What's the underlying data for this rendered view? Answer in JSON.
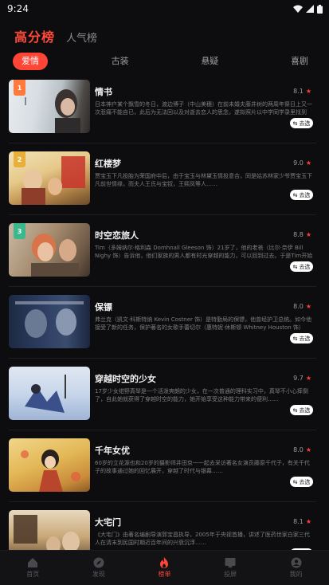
{
  "status": {
    "time": "9:24"
  },
  "top_tabs": {
    "active": "高分榜",
    "other": "人气榜"
  },
  "categories": [
    {
      "label": "爱情",
      "active": true
    },
    {
      "label": "古装",
      "active": false
    },
    {
      "label": "悬疑",
      "active": false
    },
    {
      "label": "喜剧",
      "active": false
    }
  ],
  "movies": [
    {
      "rank": "1",
      "title": "情书",
      "score": "8.1",
      "desc": "日本神户某个飘雪的冬日，渡边博子（中山美穗）在前未婚夫藤井树的两周年祭日上又一次悲痛不能自已，此后为无法回以及对逝去恋人的思念，遂拟照片以中学同学录里找到",
      "button": "去选"
    },
    {
      "rank": "2",
      "title": "红楼梦",
      "score": "9.0",
      "desc": "贾宝玉下凡投胎为荣国府中后，由于宝玉与林黛玉情投意合，同是姑苏林家少爷贾宝玉下凡前世情缘，而夫人王氏与宝钗，王熙凤等人……",
      "button": "去选"
    },
    {
      "rank": "3",
      "title": "时空恋旅人",
      "score": "8.8",
      "desc": "Tim（多姆纳尔·格利森 Domhnall Gleeson 饰）21岁了，他的老爸（比尔·奈伊 Bill Nighy 饰）告诉他，他们家族的男人都有时光穿越的能力，可以回到过去。于是Tim开始使用这种能力",
      "button": "去选"
    },
    {
      "rank": "",
      "title": "保镖",
      "score": "8.0",
      "desc": "弗兰克（凯文·科斯特纳 Kevin Costner 饰）是特勤局的保镖，他曾经护卫总统。如今他接受了新的任务，保护著名的女歌手蕾切尔（惠特妮·休斯顿 Whitney Houston 饰）",
      "button": "去选"
    },
    {
      "rank": "",
      "title": "穿越时空的少女",
      "score": "9.7",
      "desc": "17岁少女绀野真琴是一个活泼爽朗的少女，在一次普通的理科实习中，真琴不小心摔倒了，自此她就获得了穿越时空的能力，她开始享受这种能力带来的便利……",
      "button": "去选"
    },
    {
      "rank": "",
      "title": "千年女优",
      "score": "8.0",
      "desc": "60岁的立花源也和20岁的摄影师井田京一一起去采访著名女演员藤原千代子，有关千代子的故事通过她的回忆展开，穿越了时代与银幕……",
      "button": "去选"
    },
    {
      "rank": "",
      "title": "大宅门",
      "score": "8.1",
      "desc": "《大宅门》由著名编剧导演郭宝昌执导，2005年于央视首播，讲述了医药世家白家三代人在清末到民国时期近百年间的兴衰沉浮……",
      "button": "去选"
    }
  ],
  "bottom_nav": [
    {
      "label": "首页",
      "icon": "home-icon",
      "active": false
    },
    {
      "label": "发现",
      "icon": "discover-icon",
      "active": false
    },
    {
      "label": "榜单",
      "icon": "fire-icon",
      "active": true
    },
    {
      "label": "投屏",
      "icon": "cast-icon",
      "active": false
    },
    {
      "label": "我的",
      "icon": "profile-icon",
      "active": false
    }
  ],
  "colors": {
    "accent": "#ff4636",
    "background": "#0d0d0f",
    "rank1": "#ff7a3c",
    "rank2": "#e8b03a",
    "rank3": "#3cb98c"
  }
}
